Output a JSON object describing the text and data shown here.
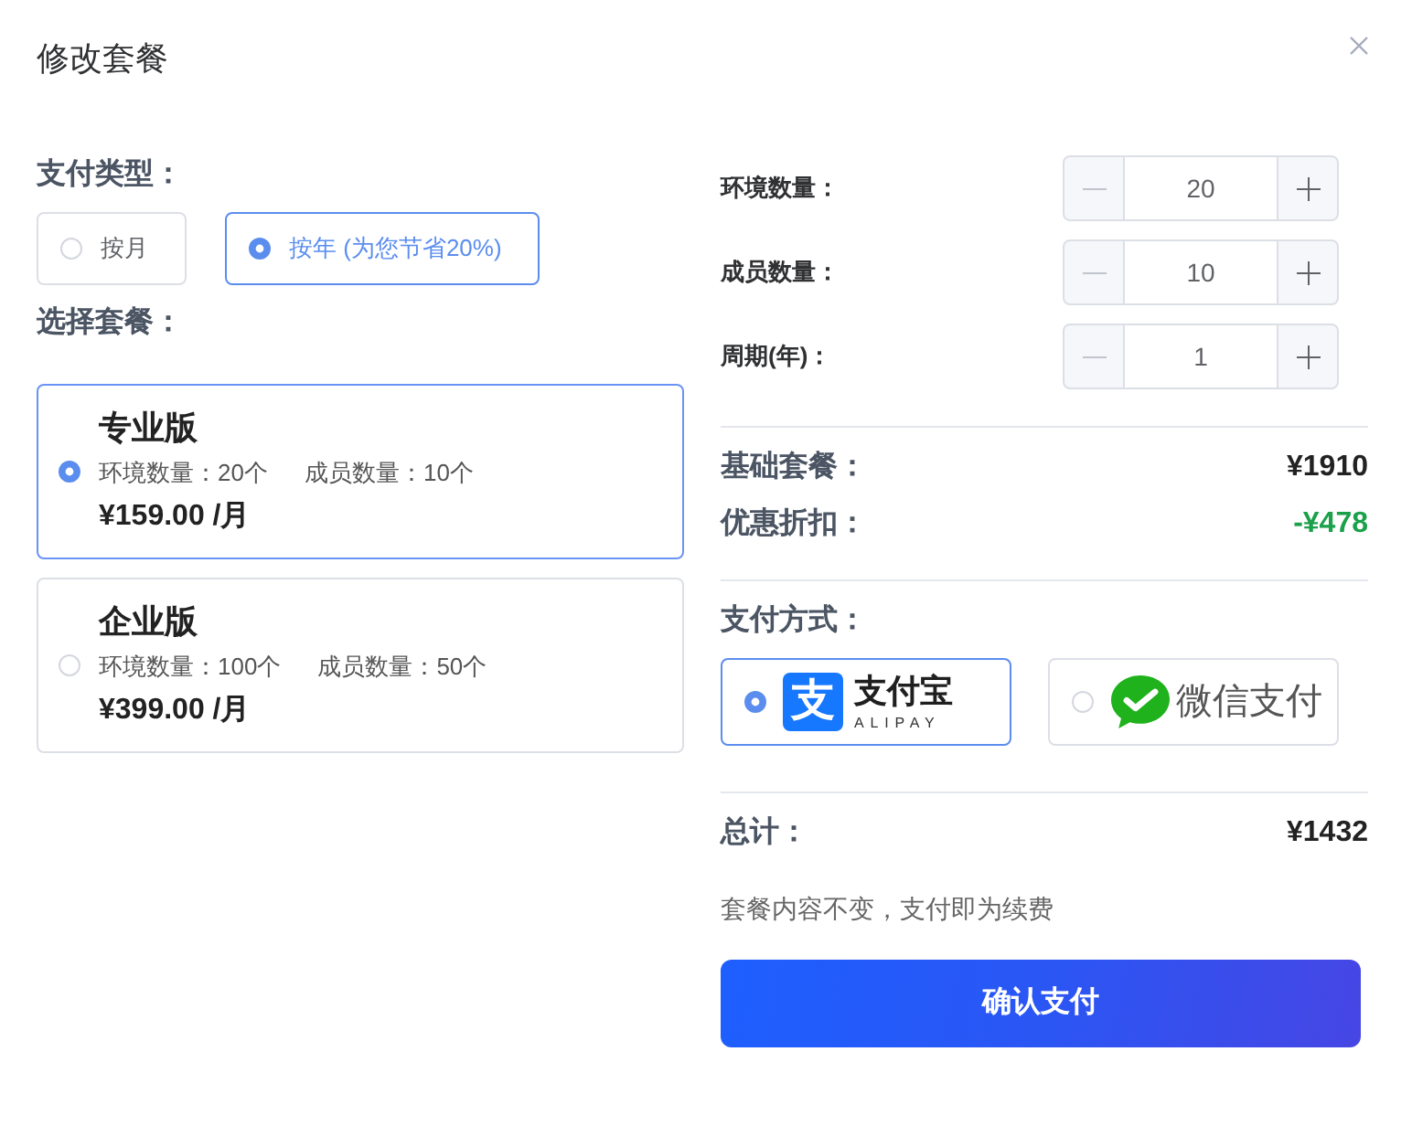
{
  "dialog": {
    "title": "修改套餐"
  },
  "payment_type": {
    "label": "支付类型：",
    "options": [
      {
        "label": "按月",
        "selected": false
      },
      {
        "label": "按年 (为您节省20%)",
        "selected": true
      }
    ]
  },
  "plan_section": {
    "label": "选择套餐：",
    "plans": [
      {
        "name": "专业版",
        "features": [
          "环境数量：20个",
          "成员数量：10个"
        ],
        "price": "¥159.00 /月",
        "selected": true
      },
      {
        "name": "企业版",
        "features": [
          "环境数量：100个",
          "成员数量：50个"
        ],
        "price": "¥399.00 /月",
        "selected": false
      }
    ]
  },
  "quantities": [
    {
      "label": "环境数量：",
      "value": "20",
      "decrease_disabled": true
    },
    {
      "label": "成员数量：",
      "value": "10",
      "decrease_disabled": true
    },
    {
      "label": "周期(年)：",
      "value": "1",
      "decrease_disabled": true
    }
  ],
  "summary": [
    {
      "kind": "base",
      "label": "基础套餐：",
      "value": "¥1910"
    },
    {
      "kind": "discount",
      "label": "优惠折扣：",
      "value": "-¥478"
    }
  ],
  "payment_method": {
    "label": "支付方式：",
    "options": [
      {
        "kind": "alipay",
        "logo_mark": "支",
        "name": "支付宝",
        "subtitle": "ALIPAY",
        "selected": true
      },
      {
        "kind": "wechat",
        "name": "微信支付",
        "selected": false
      }
    ]
  },
  "total": {
    "label": "总计：",
    "value": "¥1432"
  },
  "note": "套餐内容不变，支付即为续费",
  "confirm_button": "确认支付"
}
